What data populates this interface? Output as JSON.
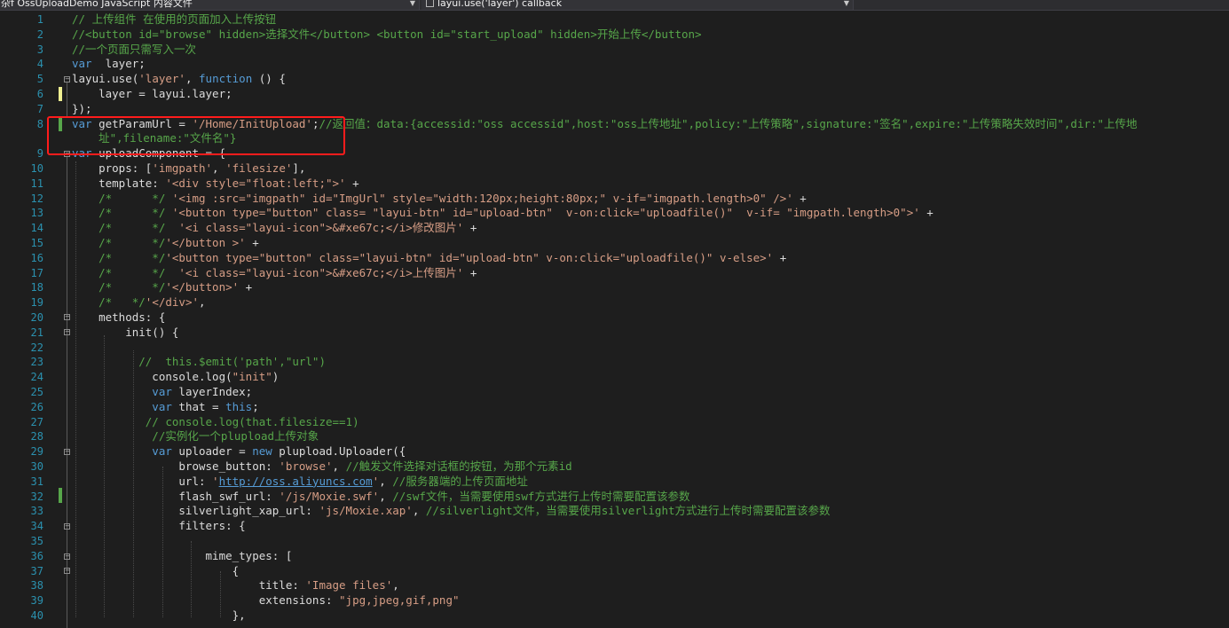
{
  "navigation": {
    "project_dropdown": "杂f OssUploadDemo JavaScript 内容文件",
    "member_dropdown": "layui.use('layer') callback"
  },
  "lines": [
    {
      "n": "1",
      "t": [
        [
          "cmt",
          "// 上传组件 在使用的页面加入上传按钮"
        ]
      ]
    },
    {
      "n": "2",
      "t": [
        [
          "cmt",
          "//<button id=\"browse\" hidden>选择文件</button> <button id=\"start_upload\" hidden>开始上传</button>"
        ]
      ]
    },
    {
      "n": "3",
      "t": [
        [
          "cmt",
          "//一个页面只需写入一次"
        ]
      ]
    },
    {
      "n": "4",
      "t": [
        [
          "kw",
          "var"
        ],
        [
          "",
          "  layer;"
        ]
      ]
    },
    {
      "n": "5",
      "t": [
        [
          "",
          "layui.use("
        ],
        [
          "str",
          "'layer'"
        ],
        [
          "",
          ", "
        ],
        [
          "kw",
          "function"
        ],
        [
          "",
          " () {"
        ]
      ]
    },
    {
      "n": "6",
      "t": [
        [
          "",
          "    layer = layui.layer;"
        ]
      ]
    },
    {
      "n": "7",
      "t": [
        [
          "",
          "});"
        ]
      ]
    },
    {
      "n": "8",
      "t": [
        [
          "kw",
          "var"
        ],
        [
          "",
          " getParamUrl = "
        ],
        [
          "str",
          "'/Home/InitUpload'"
        ],
        [
          "",
          ";"
        ],
        [
          "cmt",
          "//返回值：data:{accessid:\"oss accessid\",host:\"oss上传地址\",policy:\"上传策略\",signature:\"签名\",expire:\"上传策略失效时间\",dir:\"上传地"
        ]
      ]
    },
    {
      "n": "",
      "t": [
        [
          "cmt",
          "    址\",filename:\"文件名\"}"
        ]
      ]
    },
    {
      "n": "9",
      "t": [
        [
          "kw",
          "var"
        ],
        [
          "",
          " uploadComponent = {"
        ]
      ]
    },
    {
      "n": "10",
      "t": [
        [
          "",
          "    props: ["
        ],
        [
          "str",
          "'imgpath'"
        ],
        [
          "",
          ", "
        ],
        [
          "str",
          "'filesize'"
        ],
        [
          "",
          "],"
        ]
      ]
    },
    {
      "n": "11",
      "t": [
        [
          "",
          "    template: "
        ],
        [
          "str",
          "'<div style=\"float:left;\">'"
        ],
        [
          "",
          " +"
        ]
      ]
    },
    {
      "n": "12",
      "t": [
        [
          "cmt",
          "    /*      */"
        ],
        [
          "",
          ""
        ],
        [
          "str",
          " '<img :src=\"imgpath\" id=\"ImgUrl\" style=\"width:120px;height:80px;\" v-if=\"imgpath.length>0\" />'"
        ],
        [
          "",
          " +"
        ]
      ]
    },
    {
      "n": "13",
      "t": [
        [
          "cmt",
          "    /*      */"
        ],
        [
          "str",
          " '<button type=\"button\" class= \"layui-btn\" id=\"upload-btn\"  v-on:click=\"uploadfile()\"  v-if= \"imgpath.length>0\">'"
        ],
        [
          "",
          " +"
        ]
      ]
    },
    {
      "n": "14",
      "t": [
        [
          "cmt",
          "    /*      */"
        ],
        [
          "str",
          "  '<i class=\"layui-icon\">&#xe67c;</i>修改图片'"
        ],
        [
          "",
          " +"
        ]
      ]
    },
    {
      "n": "15",
      "t": [
        [
          "cmt",
          "    /*      */"
        ],
        [
          "str",
          "'</button >'"
        ],
        [
          "",
          " +"
        ]
      ]
    },
    {
      "n": "16",
      "t": [
        [
          "cmt",
          "    /*      */"
        ],
        [
          "str",
          "'<button type=\"button\" class=\"layui-btn\" id=\"upload-btn\" v-on:click=\"uploadfile()\" v-else>'"
        ],
        [
          "",
          " +"
        ]
      ]
    },
    {
      "n": "17",
      "t": [
        [
          "cmt",
          "    /*      */"
        ],
        [
          "str",
          "  '<i class=\"layui-icon\">&#xe67c;</i>上传图片'"
        ],
        [
          "",
          " +"
        ]
      ]
    },
    {
      "n": "18",
      "t": [
        [
          "cmt",
          "    /*      */"
        ],
        [
          "str",
          "'</button>'"
        ],
        [
          "",
          " +"
        ]
      ]
    },
    {
      "n": "19",
      "t": [
        [
          "cmt",
          "    /*   */"
        ],
        [
          "str",
          "'</div>'"
        ],
        [
          "",
          ","
        ]
      ]
    },
    {
      "n": "20",
      "t": [
        [
          "",
          "    methods: {"
        ]
      ]
    },
    {
      "n": "21",
      "t": [
        [
          "",
          "        init() {"
        ]
      ]
    },
    {
      "n": "22",
      "t": []
    },
    {
      "n": "23",
      "t": [
        [
          "cmt",
          "          //  this.$emit('path',\"url\")"
        ]
      ]
    },
    {
      "n": "24",
      "t": [
        [
          "",
          "            console.log("
        ],
        [
          "str",
          "\"init\""
        ],
        [
          "",
          ")"
        ]
      ]
    },
    {
      "n": "25",
      "t": [
        [
          "kw",
          "            var"
        ],
        [
          "",
          " layerIndex;"
        ]
      ]
    },
    {
      "n": "26",
      "t": [
        [
          "kw",
          "            var"
        ],
        [
          "",
          " that = "
        ],
        [
          "kw",
          "this"
        ],
        [
          "",
          ";"
        ]
      ]
    },
    {
      "n": "27",
      "t": [
        [
          "cmt",
          "           // console.log(that.filesize==1)"
        ]
      ]
    },
    {
      "n": "28",
      "t": [
        [
          "cmt",
          "            //实例化一个plupload上传对象"
        ]
      ]
    },
    {
      "n": "29",
      "t": [
        [
          "kw",
          "            var"
        ],
        [
          "",
          " uploader = "
        ],
        [
          "kw",
          "new"
        ],
        [
          "",
          " plupload.Uploader({"
        ]
      ]
    },
    {
      "n": "30",
      "t": [
        [
          "",
          "                browse_button: "
        ],
        [
          "str",
          "'browse'"
        ],
        [
          "",
          ", "
        ],
        [
          "cmt",
          "//触发文件选择对话框的按钮，为那个元素id"
        ]
      ]
    },
    {
      "n": "31",
      "t": [
        [
          "",
          "                url: "
        ],
        [
          "str",
          "'"
        ],
        [
          "link",
          "http://oss.aliyuncs.com"
        ],
        [
          "str",
          "'"
        ],
        [
          "",
          ", "
        ],
        [
          "cmt",
          "//服务器端的上传页面地址"
        ]
      ]
    },
    {
      "n": "32",
      "t": [
        [
          "",
          "                flash_swf_url: "
        ],
        [
          "str",
          "'/js/Moxie.swf'"
        ],
        [
          "",
          ", "
        ],
        [
          "cmt",
          "//swf文件，当需要使用swf方式进行上传时需要配置该参数"
        ]
      ]
    },
    {
      "n": "33",
      "t": [
        [
          "",
          "                silverlight_xap_url: "
        ],
        [
          "str",
          "'js/Moxie.xap'"
        ],
        [
          "",
          ", "
        ],
        [
          "cmt",
          "//silverlight文件，当需要使用silverlight方式进行上传时需要配置该参数"
        ]
      ]
    },
    {
      "n": "34",
      "t": [
        [
          "",
          "                filters: {"
        ]
      ]
    },
    {
      "n": "35",
      "t": []
    },
    {
      "n": "36",
      "t": [
        [
          "",
          "                    mime_types: ["
        ]
      ]
    },
    {
      "n": "37",
      "t": [
        [
          "",
          "                        {"
        ]
      ]
    },
    {
      "n": "38",
      "t": [
        [
          "",
          "                            title: "
        ],
        [
          "str",
          "'Image files'"
        ],
        [
          "",
          ","
        ]
      ]
    },
    {
      "n": "39",
      "t": [
        [
          "",
          "                            extensions: "
        ],
        [
          "str",
          "\"jpg,jpeg,gif,png\""
        ]
      ]
    },
    {
      "n": "40",
      "t": [
        [
          "",
          "                        },"
        ]
      ]
    }
  ]
}
